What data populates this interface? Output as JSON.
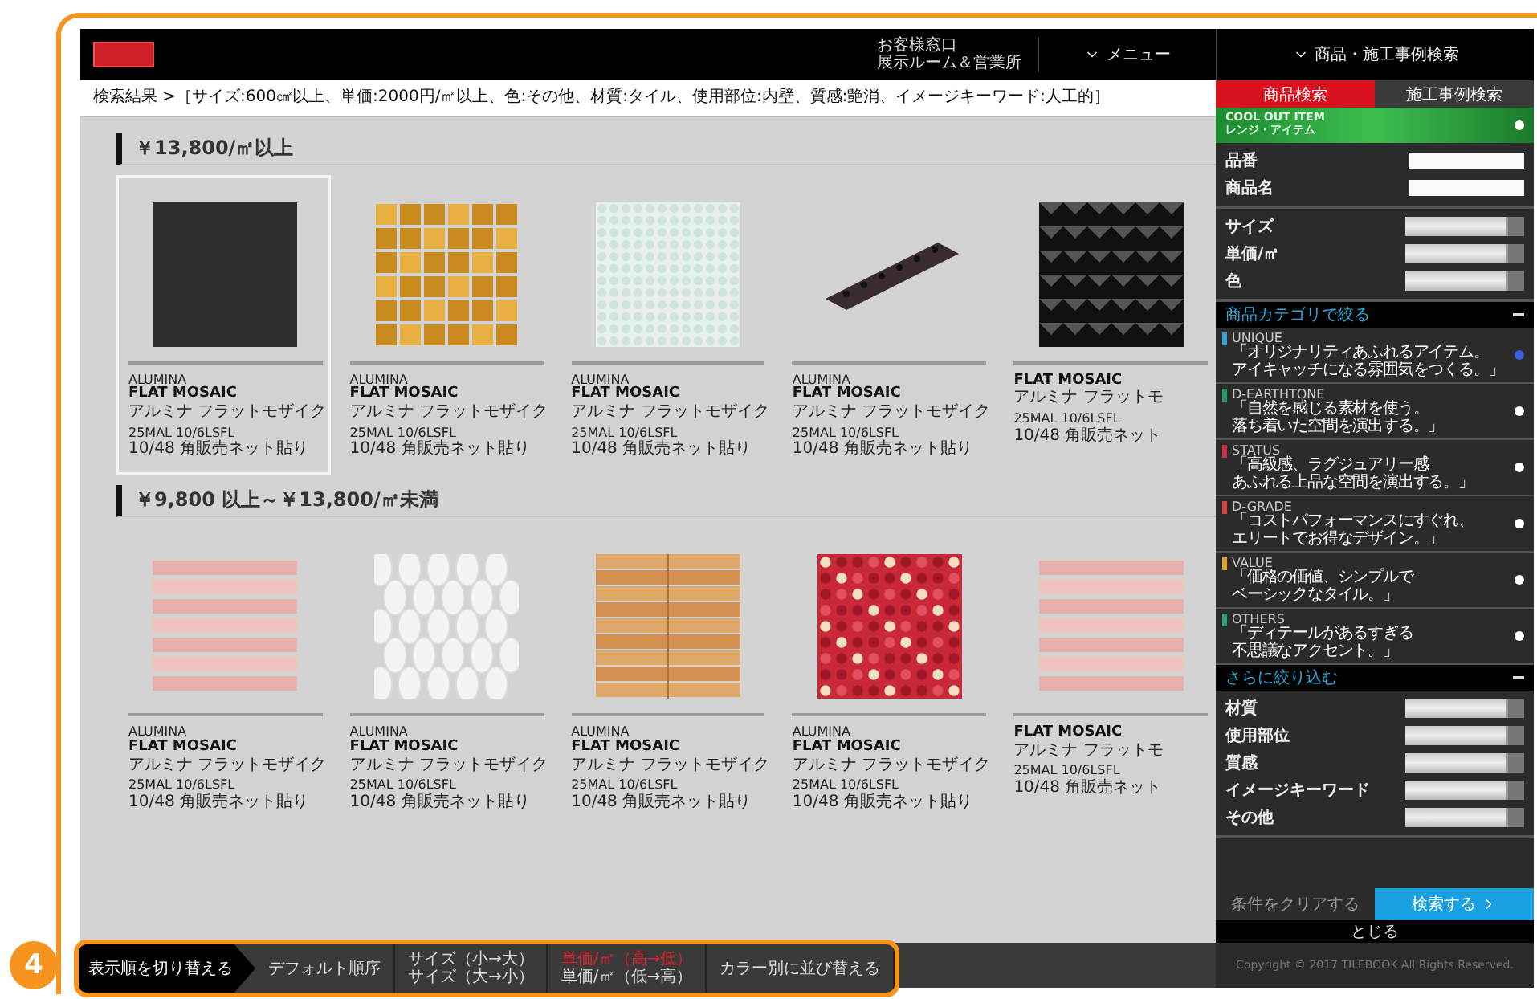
{
  "annotation": {
    "badge": "4"
  },
  "header": {
    "contact": [
      "お客様窓口",
      "展示ルーム＆営業所"
    ],
    "menu": "メニュー"
  },
  "breadcrumb": "検索結果 >［サイズ:600㎠以上、単価:2000円/㎡以上、色:その他、材質:タイル、使用部位:内壁、質感:艶消、イメージキーワード:人工的］",
  "sections": [
    {
      "heading": "￥13,800/㎡以上",
      "products": [
        {
          "kind": "dark",
          "selected": true,
          "brand": "ALUMINA",
          "name": "FLAT MOSAIC",
          "name_ja": "アルミナ フラットモザイク",
          "code": "25MAL 10/6LSFL",
          "note": "10/48 角販売ネット貼り"
        },
        {
          "kind": "gold",
          "selected": false,
          "brand": "ALUMINA",
          "name": "FLAT MOSAIC",
          "name_ja": "アルミナ フラットモザイク",
          "code": "25MAL 10/6LSFL",
          "note": "10/48 角販売ネット貼り"
        },
        {
          "kind": "glass",
          "selected": false,
          "brand": "ALUMINA",
          "name": "FLAT MOSAIC",
          "name_ja": "アルミナ フラットモザイク",
          "code": "25MAL 10/6LSFL",
          "note": "10/48 角販売ネット貼り"
        },
        {
          "kind": "brick",
          "selected": false,
          "brand": "ALUMINA",
          "name": "FLAT MOSAIC",
          "name_ja": "アルミナ フラットモザイク",
          "code": "25MAL 10/6LSFL",
          "note": "10/48 角販売ネット貼り"
        },
        {
          "kind": "pyramid",
          "selected": false,
          "name": "FLAT MOSAIC",
          "name_ja": "アルミナ フラットモ",
          "code": "25MAL 10/6LSFL",
          "note": "10/48 角販売ネット"
        }
      ]
    },
    {
      "heading": "￥9,800 以上～￥13,800/㎡未満",
      "products": [
        {
          "kind": "pink-strips",
          "selected": false,
          "brand": "ALUMINA",
          "name": "FLAT MOSAIC",
          "name_ja": "アルミナ フラットモザイク",
          "code": "25MAL 10/6LSFL",
          "note": "10/48 角販売ネット貼り"
        },
        {
          "kind": "hexagon",
          "selected": false,
          "brand": "ALUMINA",
          "name": "FLAT MOSAIC",
          "name_ja": "アルミナ フラットモザイク",
          "code": "25MAL 10/6LSFL",
          "note": "10/48 角販売ネット貼り"
        },
        {
          "kind": "wood",
          "selected": false,
          "brand": "ALUMINA",
          "name": "FLAT MOSAIC",
          "name_ja": "アルミナ フラットモザイク",
          "code": "25MAL 10/6LSFL",
          "note": "10/48 角販売ネット貼り"
        },
        {
          "kind": "floral",
          "selected": false,
          "brand": "ALUMINA",
          "name": "FLAT MOSAIC",
          "name_ja": "アルミナ フラットモザイク",
          "code": "25MAL 10/6LSFL",
          "note": "10/48 角販売ネット貼り"
        },
        {
          "kind": "pink-strips",
          "selected": false,
          "name": "FLAT MOSAIC",
          "name_ja": "アルミナ フラットモ",
          "code": "25MAL 10/6LSFL",
          "note": "10/48 角販売ネット"
        }
      ]
    }
  ],
  "sidebar": {
    "title": "商品・施工事例検索",
    "tabs": [
      {
        "label": "商品検索",
        "selected": true
      },
      {
        "label": "施工事例検索",
        "selected": false
      }
    ],
    "banner": [
      "COOL OUT ITEM",
      "レンジ・アイテム"
    ],
    "text_fields": [
      {
        "label": "品番"
      },
      {
        "label": "商品名"
      }
    ],
    "selects": [
      {
        "label": "サイズ"
      },
      {
        "label": "単価/㎡"
      },
      {
        "label": "色"
      }
    ],
    "category_header": "商品カテゴリで絞る",
    "categories": [
      {
        "code": "UNIQUE",
        "color": "#3aa0d8",
        "selected": true,
        "desc": [
          "「オリジナリティあふれるアイテム。",
          "アイキャッチになる雰囲気をつくる。」"
        ]
      },
      {
        "code": "D-EARTHTONE",
        "color": "#2a9a6a",
        "selected": false,
        "desc": [
          "「自然を感じる素材を使う。",
          "落ち着いた空間を演出する。」"
        ]
      },
      {
        "code": "STATUS",
        "color": "#c8304a",
        "selected": false,
        "desc": [
          "「高級感、ラグジュアリー感",
          "あふれる上品な空間を演出する。」"
        ]
      },
      {
        "code": "D-GRADE",
        "color": "#d84040",
        "selected": false,
        "desc": [
          "「コストパフォーマンスにすぐれ、",
          "エリートでお得なデザイン。」"
        ]
      },
      {
        "code": "VALUE",
        "color": "#e0a030",
        "selected": false,
        "desc": [
          "「価格の価値、シンプルで",
          "ベーシックなタイル。」"
        ]
      },
      {
        "code": "OTHERS",
        "color": "#30a080",
        "selected": false,
        "desc": [
          "「ディテールがあるすぎる",
          "不思議なアクセント。」"
        ]
      }
    ],
    "refine_header": "さらに絞り込む",
    "refine_selects": [
      {
        "label": "材質"
      },
      {
        "label": "使用部位"
      },
      {
        "label": "質感"
      },
      {
        "label": "イメージキーワード"
      },
      {
        "label": "その他"
      }
    ],
    "clear": "条件をクリアする",
    "search": "検索する",
    "close": "とじる"
  },
  "sort_bar": {
    "title": "表示順を切り替える",
    "groups": [
      {
        "options": [
          {
            "label": "デフォルト順序",
            "selected": false
          }
        ]
      },
      {
        "options": [
          {
            "label": "サイズ（小→大）",
            "selected": false
          },
          {
            "label": "サイズ（大→小）",
            "selected": false
          }
        ]
      },
      {
        "options": [
          {
            "label": "単価/㎡（高→低）",
            "selected": true
          },
          {
            "label": "単価/㎡（低→高）",
            "selected": false
          }
        ]
      },
      {
        "options": [
          {
            "label": "カラー別に並び替える",
            "selected": false
          }
        ]
      }
    ],
    "copyright": "Copyright © 2017 TILEBOOK All Rights Reserved."
  }
}
